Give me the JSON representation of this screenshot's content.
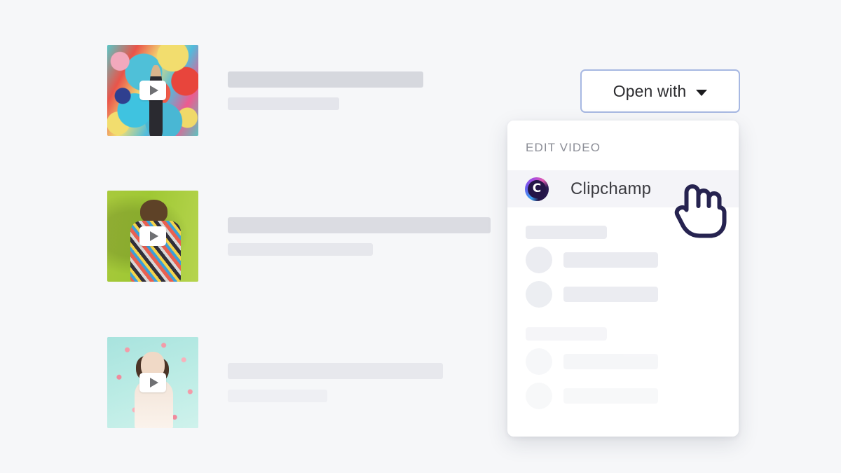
{
  "page": {
    "background_color": "#f6f7f9",
    "title": "Open with Clipchamp video editor menu"
  },
  "file_list": {
    "rows": [
      {
        "thumbnail_name": "graffiti-mural-video-thumbnail",
        "play_icon": "play-icon",
        "title_placeholder": "",
        "subtitle_placeholder": ""
      },
      {
        "thumbnail_name": "green-wall-portrait-video-thumbnail",
        "play_icon": "play-icon",
        "title_placeholder": "",
        "subtitle_placeholder": ""
      },
      {
        "thumbnail_name": "mint-confetti-portrait-video-thumbnail",
        "play_icon": "play-icon",
        "title_placeholder": "",
        "subtitle_placeholder": ""
      }
    ]
  },
  "open_with_button": {
    "label": "Open with",
    "caret_icon": "chevron-down-icon",
    "border_color": "#a7b8e2",
    "background_color": "#ffffff",
    "text_color": "#2b2b2e"
  },
  "dropdown": {
    "section_heading": "EDIT VIDEO",
    "heading_color": "#8b8d96",
    "items": [
      {
        "label": "Clipchamp",
        "icon": "clipchamp-logo-icon",
        "icon_glyph": "C",
        "highlighted": true,
        "highlight_color": "#f4f4f8",
        "brand_colors": [
          "#3aa0f0",
          "#6b5cf0",
          "#a64ae0",
          "#e05ab0",
          "#241547"
        ]
      }
    ],
    "skeleton_groups": [
      {
        "name": "group-1",
        "opacity": 1,
        "header_bar": true,
        "rows": 2
      },
      {
        "name": "group-2",
        "opacity": 0.45,
        "header_bar": true,
        "rows": 2
      }
    ],
    "background_color": "#ffffff"
  },
  "cursor": {
    "icon": "hand-pointer-cursor",
    "outline_color": "#262350",
    "fill_color": "#ffffff"
  }
}
